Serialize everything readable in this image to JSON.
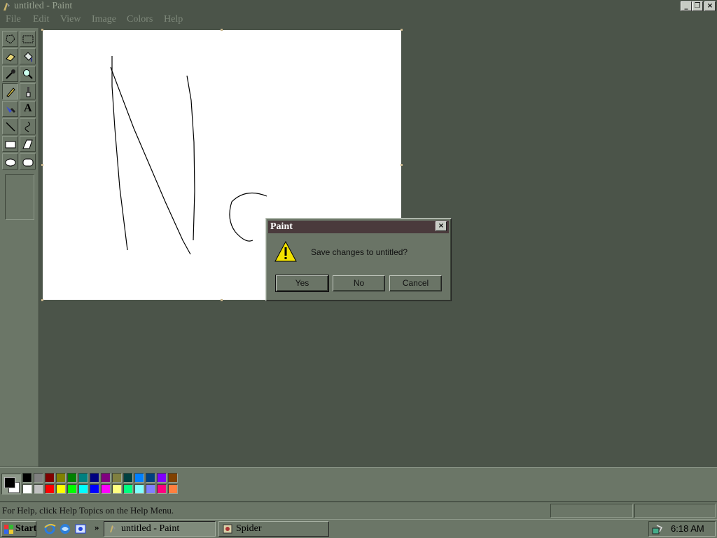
{
  "window": {
    "title": "untitled - Paint",
    "minimize_label": "_",
    "restore_label": "❐",
    "close_label": "×"
  },
  "menu": [
    {
      "label": "File"
    },
    {
      "label": "Edit"
    },
    {
      "label": "View"
    },
    {
      "label": "Image"
    },
    {
      "label": "Colors"
    },
    {
      "label": "Help"
    }
  ],
  "tools": [
    {
      "name": "free-form-select"
    },
    {
      "name": "rectangle-select"
    },
    {
      "name": "eraser"
    },
    {
      "name": "fill"
    },
    {
      "name": "pick-color"
    },
    {
      "name": "magnifier"
    },
    {
      "name": "pencil",
      "active": true
    },
    {
      "name": "brush"
    },
    {
      "name": "airbrush"
    },
    {
      "name": "text"
    },
    {
      "name": "line"
    },
    {
      "name": "curve"
    },
    {
      "name": "rectangle"
    },
    {
      "name": "polygon"
    },
    {
      "name": "ellipse"
    },
    {
      "name": "rounded-rectangle"
    }
  ],
  "text_tool_glyph": "A",
  "dialog": {
    "title": "Paint",
    "close_label": "×",
    "message": "Save changes to untitled?",
    "buttons": {
      "yes": "Yes",
      "no": "No",
      "cancel": "Cancel"
    }
  },
  "palette": {
    "foreground": "#000000",
    "background": "#ffffff",
    "row1": [
      "#000000",
      "#808080",
      "#800000",
      "#808000",
      "#008000",
      "#008080",
      "#000080",
      "#800080",
      "#808040",
      "#004040",
      "#0080ff",
      "#004080",
      "#8000ff",
      "#804000"
    ],
    "row2": [
      "#ffffff",
      "#c0c0c0",
      "#ff0000",
      "#ffff00",
      "#00ff00",
      "#00ffff",
      "#0000ff",
      "#ff00ff",
      "#ffff80",
      "#00ff80",
      "#80ffff",
      "#8080ff",
      "#ff0080",
      "#ff8040"
    ]
  },
  "status": {
    "help_text": "For Help, click Help Topics on the Help Menu."
  },
  "taskbar": {
    "start_label": "Start",
    "chevron": "»",
    "tasks": [
      {
        "label": "untitled - Paint",
        "active": true
      },
      {
        "label": "Spider",
        "active": false
      }
    ],
    "clock": "6:18 AM"
  }
}
